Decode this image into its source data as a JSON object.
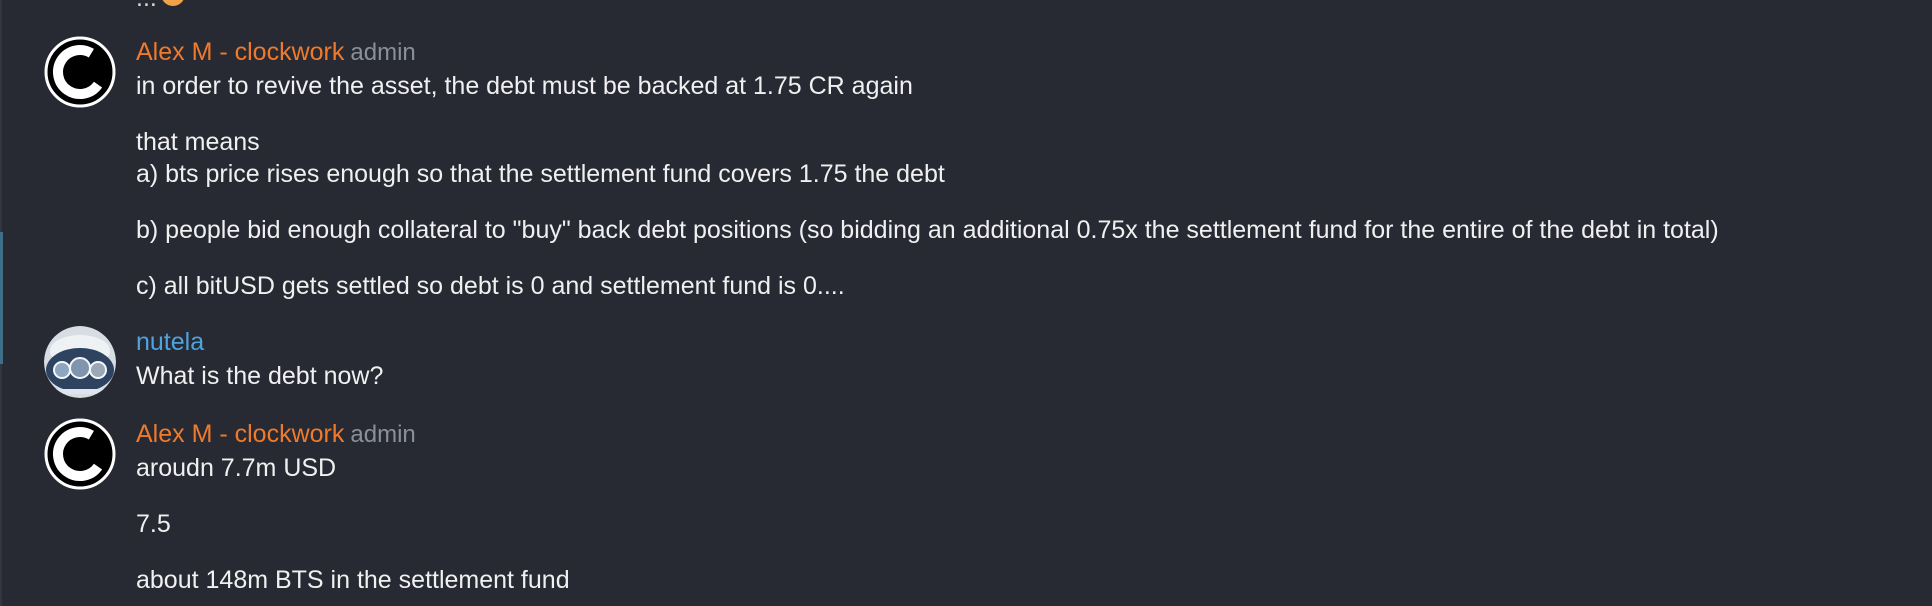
{
  "chat": {
    "partial_top_text": "...",
    "messages": [
      {
        "author": "Alex M - clockwork",
        "role": "admin",
        "avatar": "clockwork-logo-icon",
        "paragraphs": [
          "in order to revive the asset, the debt must be backed at 1.75 CR again",
          "that means",
          "a) bts price rises enough so that the settlement fund covers 1.75 the debt",
          "b) people bid enough collateral to \"buy\" back debt positions (so bidding an additional 0.75x the settlement fund for the entire of the debt in total)",
          "c) all bitUSD gets settled so debt is 0 and settlement fund is 0...."
        ]
      },
      {
        "author": "nutela",
        "role": "",
        "avatar": "photo-avatar-icon",
        "paragraphs": [
          "What is the debt now?"
        ]
      },
      {
        "author": "Alex M - clockwork",
        "role": "admin",
        "avatar": "clockwork-logo-icon",
        "paragraphs": [
          "aroudn 7.7m USD",
          "7.5",
          "about 148m BTS in the settlement fund"
        ]
      }
    ]
  }
}
